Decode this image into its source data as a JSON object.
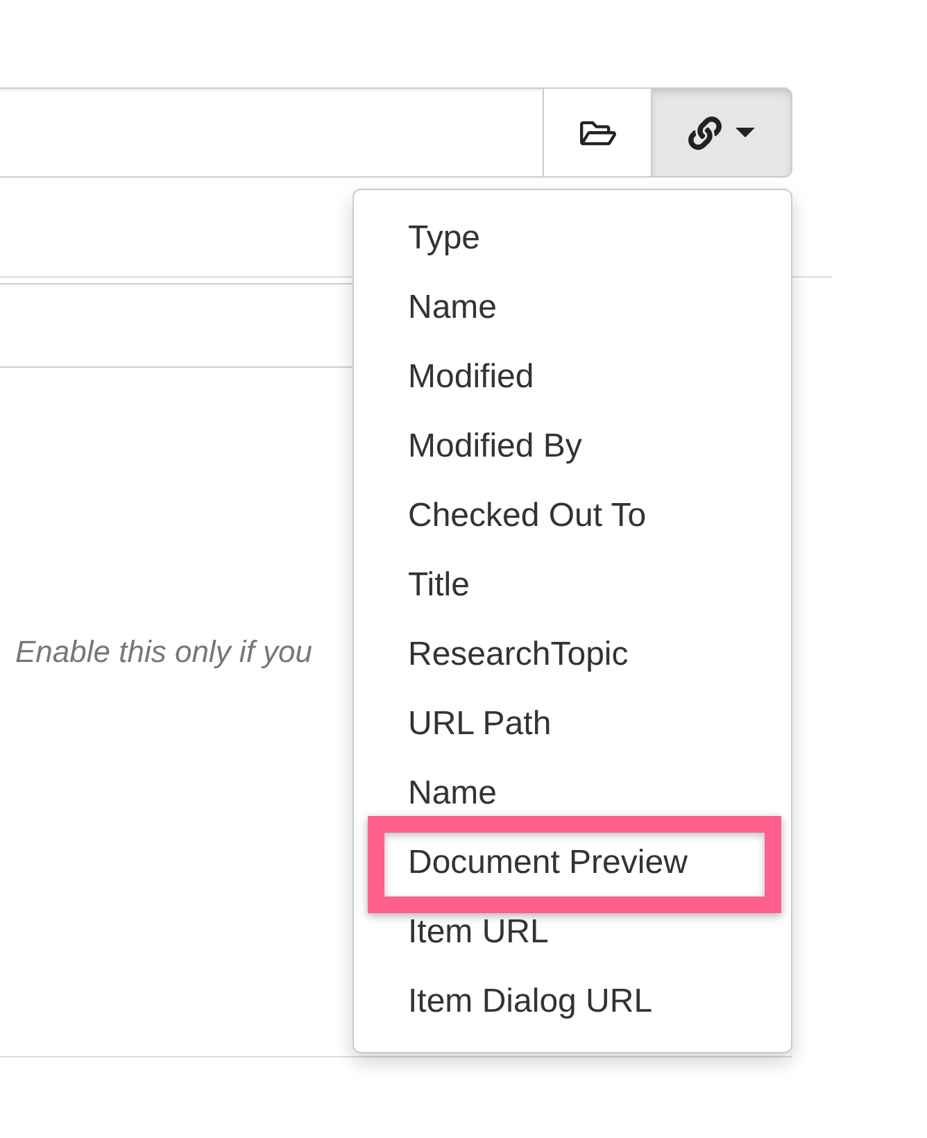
{
  "path_field": {
    "folder_button": {
      "kind": "folder"
    },
    "link_button": {
      "open": true
    }
  },
  "hint": "Enable this only if you",
  "menu": {
    "items": [
      {
        "label": "Type",
        "highlighted": false
      },
      {
        "label": "Name",
        "highlighted": false
      },
      {
        "label": "Modified",
        "highlighted": false
      },
      {
        "label": "Modified By",
        "highlighted": false
      },
      {
        "label": "Checked Out To",
        "highlighted": false
      },
      {
        "label": "Title",
        "highlighted": false
      },
      {
        "label": "ResearchTopic",
        "highlighted": false
      },
      {
        "label": "URL Path",
        "highlighted": false
      },
      {
        "label": "Name",
        "highlighted": false
      },
      {
        "label": "Document Preview",
        "highlighted": true
      },
      {
        "label": "Item URL",
        "highlighted": false
      },
      {
        "label": "Item Dialog URL",
        "highlighted": false
      }
    ]
  }
}
